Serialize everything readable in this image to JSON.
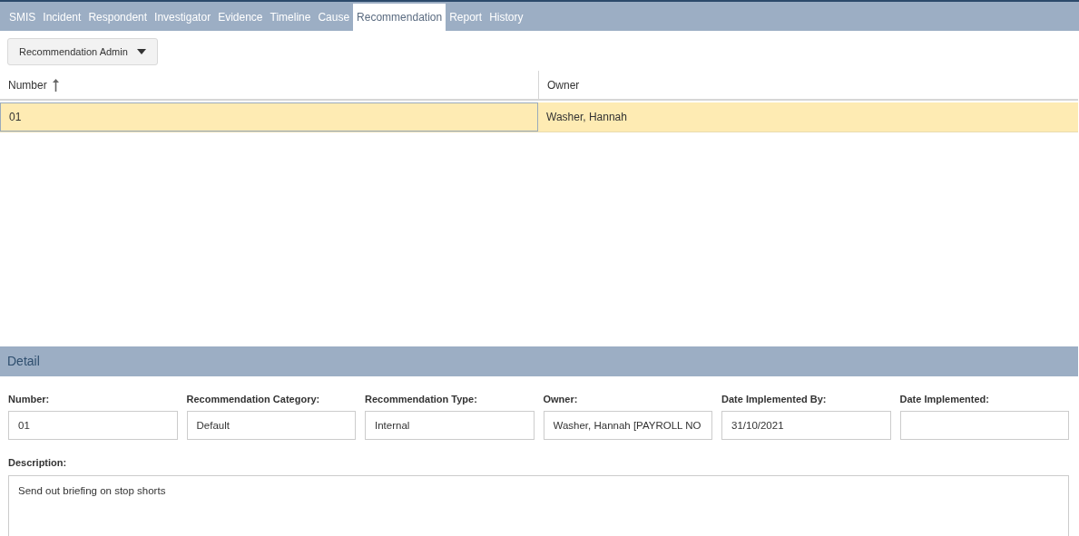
{
  "tabs": [
    {
      "label": "SMIS",
      "selected": false
    },
    {
      "label": "Incident",
      "selected": false
    },
    {
      "label": "Respondent",
      "selected": false
    },
    {
      "label": "Investigator",
      "selected": false
    },
    {
      "label": "Evidence",
      "selected": false
    },
    {
      "label": "Timeline",
      "selected": false
    },
    {
      "label": "Cause",
      "selected": false
    },
    {
      "label": "Recommendation",
      "selected": true
    },
    {
      "label": "Report",
      "selected": false
    },
    {
      "label": "History",
      "selected": false
    }
  ],
  "toolbar": {
    "menu_button": "Recommendation Admin"
  },
  "table": {
    "columns": [
      {
        "label": "Number",
        "sorted": true
      },
      {
        "label": "Owner",
        "sorted": false
      }
    ],
    "rows": [
      {
        "cells": [
          "01",
          "Washer, Hannah"
        ],
        "selected": true
      }
    ]
  },
  "detail": {
    "title": "Detail",
    "fields": [
      {
        "label": "Number:",
        "value": "01"
      },
      {
        "label": "Recommendation Category:",
        "value": "Default"
      },
      {
        "label": "Recommendation Type:",
        "value": "Internal"
      },
      {
        "label": "Owner:",
        "value": "Washer, Hannah [PAYROLL NO"
      },
      {
        "label": "Date Implemented By:",
        "value": "31/10/2021"
      },
      {
        "label": "Date Implemented:"
      }
    ],
    "description": {
      "label": "Description:",
      "value": "Send out briefing on stop shorts"
    }
  }
}
